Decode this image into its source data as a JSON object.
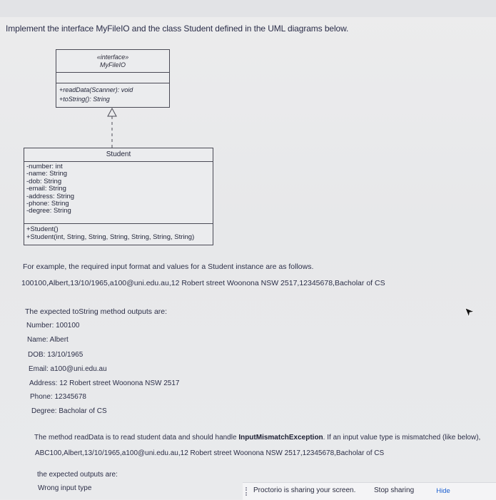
{
  "instruction": "Implement the interface MyFileIO and the class Student defined in the UML diagrams below.",
  "interface_box": {
    "stereotype": "«interface»",
    "name": "MyFileIO",
    "operations": [
      "+readData(Scanner): void",
      "+toString(): String"
    ]
  },
  "class_box": {
    "name": "Student",
    "attributes": [
      "-number: int",
      "-name: String",
      "-dob: String",
      "-email: String",
      "-address: String",
      "-phone: String",
      "-degree: String"
    ],
    "operations": [
      "+Student()",
      "+Student(int, String, String, String, String, String, String)"
    ]
  },
  "example": {
    "intro": "For example, the required input format and values for a Student instance are as follows.",
    "input": "100100,Albert,13/10/1965,a100@uni.edu.au,12 Robert street Woonona NSW 2517,12345678,Bacholar of CS"
  },
  "tostring": {
    "intro": "The expected toString method outputs are:",
    "lines": [
      "Number: 100100",
      "Name: Albert",
      "DOB: 13/10/1965",
      "Email: a100@uni.edu.au",
      "Address: 12 Robert street Woonona NSW 2517",
      "Phone: 12345678",
      "Degree: Bacholar of CS"
    ]
  },
  "readdata": {
    "text_before": "The method readData is to read student data and should handle ",
    "exception": "InputMismatchException",
    "text_after": ". If an input value type is mismatched (like below),",
    "input": "ABC100,Albert,13/10/1965,a100@uni.edu.au,12 Robert street Woonona NSW 2517,12345678,Bacholar of CS",
    "expected_intro": "the expected outputs are:",
    "wrong_input": "Wrong input type"
  },
  "sharing_bar": {
    "message": "Proctorio is sharing your screen.",
    "stop_label": "Stop sharing",
    "hide_label": "Hide"
  }
}
